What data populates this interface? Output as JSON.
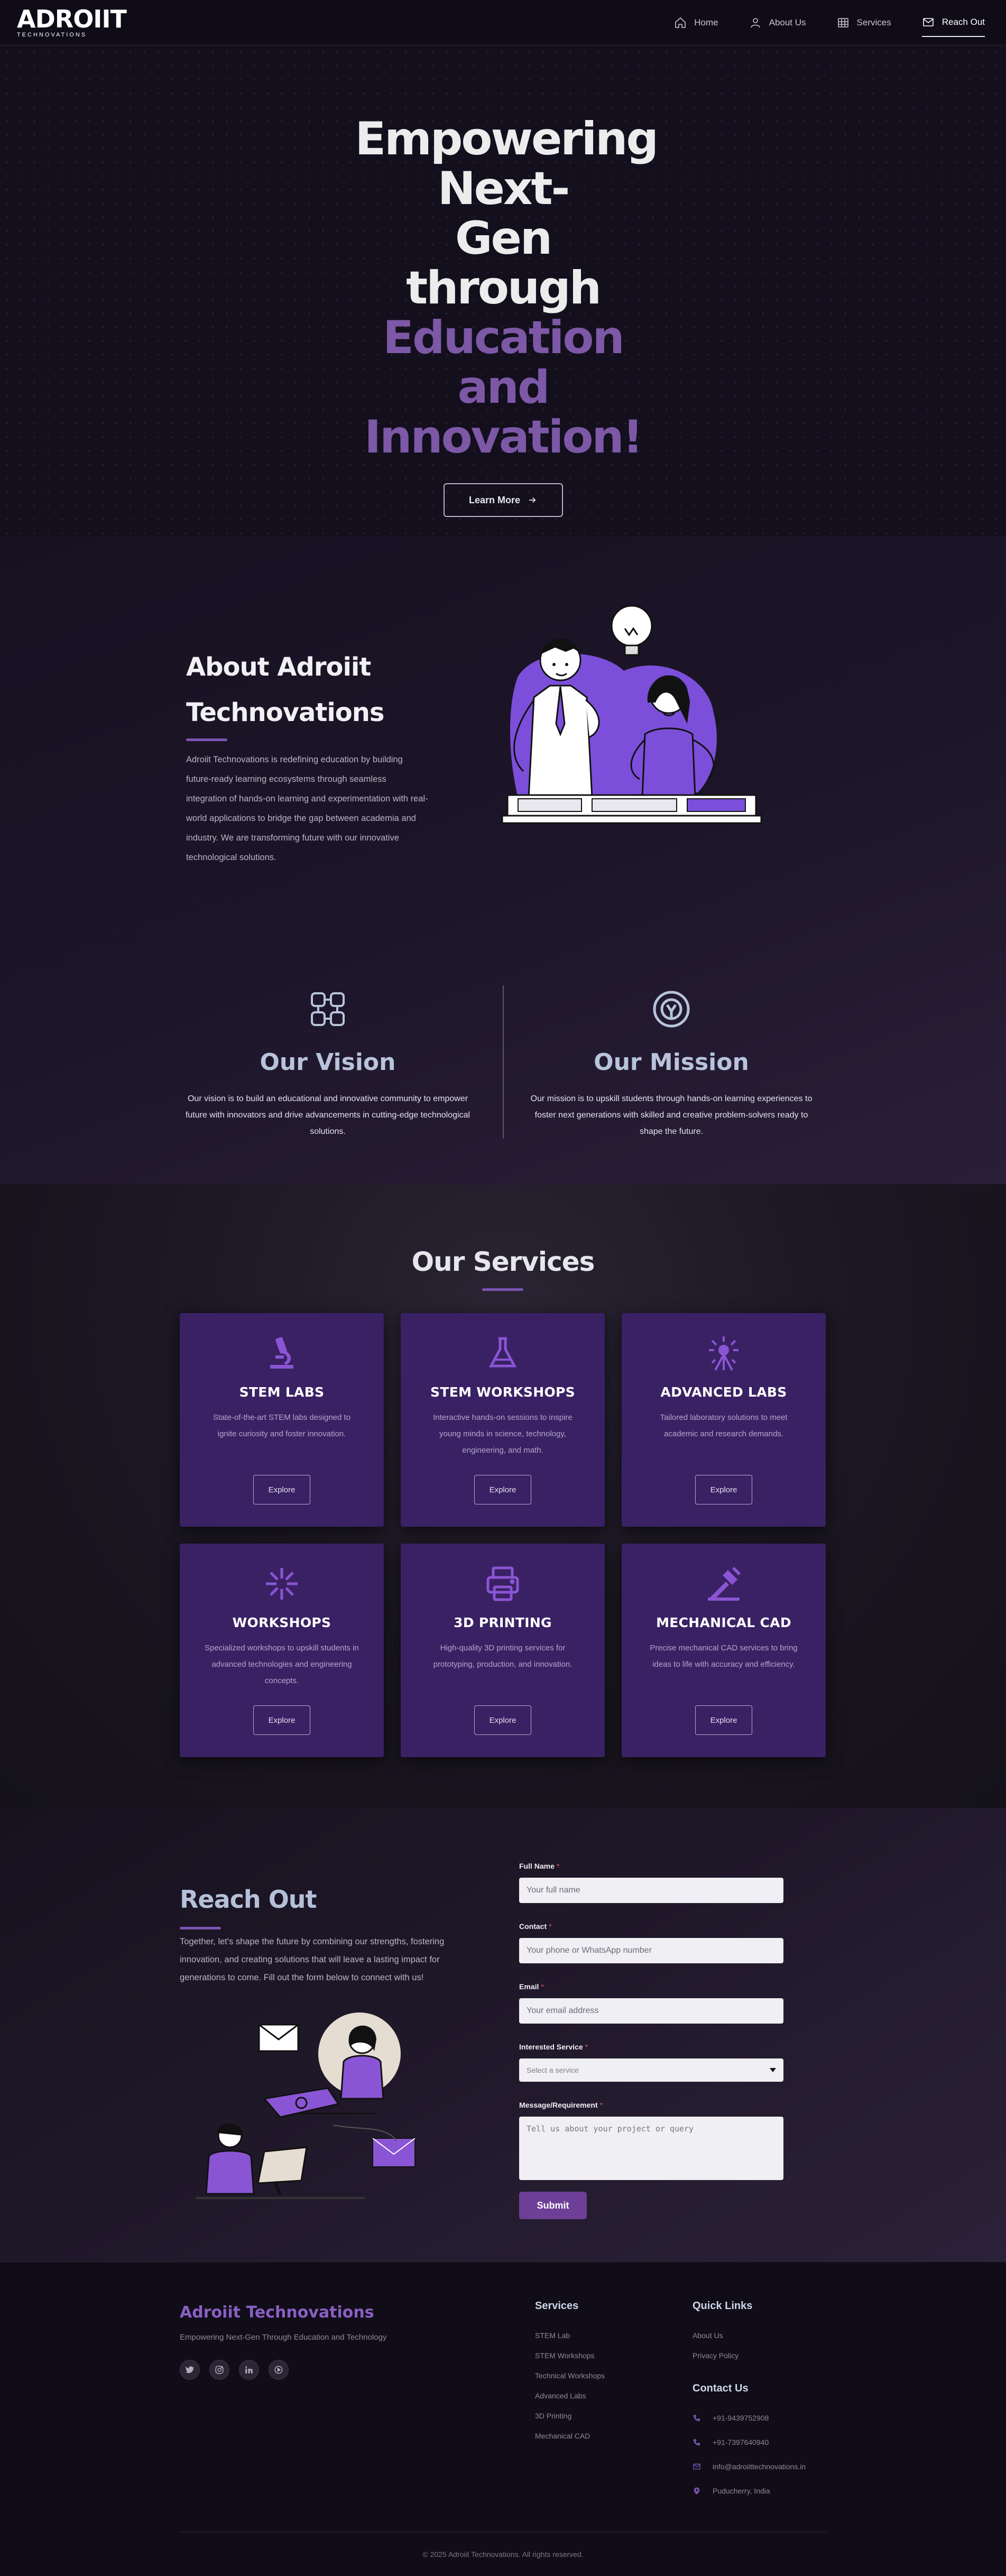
{
  "nav": {
    "logo_main": "ADROIIT",
    "logo_sub": "TECHNOVATIONS",
    "links": [
      {
        "label": "Home",
        "icon": "home-icon"
      },
      {
        "label": "About Us",
        "icon": "user-icon"
      },
      {
        "label": "Services",
        "icon": "grid-icon"
      },
      {
        "label": "Reach Out",
        "icon": "mail-icon"
      }
    ]
  },
  "hero": {
    "lines_white": [
      "Empowering",
      "Next-",
      "Gen through"
    ],
    "lines_purple": [
      "Education",
      "and",
      "Innovation!"
    ],
    "button": "Learn More"
  },
  "about": {
    "title": "About Adroiit Technovations",
    "text": "Adroiit Technovations is redefining education by building future-ready learning ecosystems through seamless integration of hands-on learning and experimentation with real-world applications to bridge the gap between academia and industry. We are transforming future with our innovative technological solutions."
  },
  "vision": {
    "title": "Our Vision",
    "text": "Our vision is to build an educational and innovative community to empower future with innovators and drive advancements in cutting-edge technological solutions."
  },
  "mission": {
    "title": "Our Mission",
    "text": "Our mission is to upskill students through hands-on learning experiences to foster next generations with skilled and creative problem-solvers ready to shape the future."
  },
  "services": {
    "title": "Our Services",
    "cards": [
      {
        "title": "STEM LABS",
        "text": "State-of-the-art STEM labs designed to ignite curiosity and foster innovation.",
        "button": "Explore",
        "icon": "microscope-icon"
      },
      {
        "title": "STEM WORKSHOPS",
        "text": "Interactive hands-on sessions to inspire young minds in science, technology, engineering, and math.",
        "button": "Explore",
        "icon": "flask-icon"
      },
      {
        "title": "ADVANCED LABS",
        "text": "Tailored laboratory solutions to meet academic and research demands.",
        "button": "Explore",
        "icon": "antenna-icon"
      },
      {
        "title": "WORKSHOPS",
        "text": "Specialized workshops to upskill students in advanced technologies and engineering concepts.",
        "button": "Explore",
        "icon": "spark-icon"
      },
      {
        "title": "3D PRINTING",
        "text": "High-quality 3D printing services for prototyping, production, and innovation.",
        "button": "Explore",
        "icon": "printer-icon"
      },
      {
        "title": "MECHANICAL CAD",
        "text": "Precise mechanical CAD services to bring ideas to life with accuracy and efficiency.",
        "button": "Explore",
        "icon": "drafting-icon"
      }
    ]
  },
  "reach": {
    "title": "Reach Out",
    "text": "Together, let's shape the future by combining our strengths, fostering innovation, and creating solutions that will leave a lasting impact for generations to come. Fill out the form below to connect with us!",
    "form": {
      "name_label": "Full Name",
      "name_placeholder": "Your full name",
      "contact_label": "Contact",
      "contact_placeholder": "Your phone or WhatsApp number",
      "email_label": "Email",
      "email_placeholder": "Your email address",
      "service_label": "Interested Service",
      "service_value": "Select a service",
      "message_label": "Message/Requirement",
      "message_placeholder": "Tell us about your project or query",
      "required_mark": "*",
      "submit": "Submit"
    }
  },
  "footer": {
    "brand": "Adroiit Technovations",
    "tagline": "Empowering Next-Gen Through Education and Technology",
    "socials": [
      "twitter-icon",
      "instagram-icon",
      "linkedin-icon",
      "youtube-icon"
    ],
    "services_title": "Services",
    "services": [
      "STEM Lab",
      "STEM Workshops",
      "Technical Workshops",
      "Advanced Labs",
      "3D Printing",
      "Mechanical CAD"
    ],
    "quick_title": "Quick Links",
    "quick": [
      "About Us",
      "Privacy Policy"
    ],
    "contact_title": "Contact Us",
    "contacts": [
      "+91-9439752908",
      "+91-7397640940",
      "info@adroiittechnovations.in",
      "Puducherry, India"
    ],
    "copyright": "© 2025 Adroiit Technovations. All rights reserved."
  },
  "colors": {
    "accent": "#7a55b3",
    "card": "#3a2164",
    "hero_purple": "#7c58a6",
    "submit": "#6d3f97"
  }
}
